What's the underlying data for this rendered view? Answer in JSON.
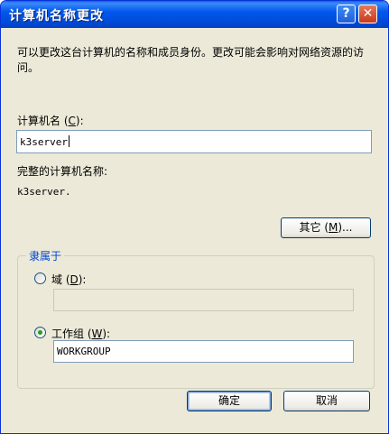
{
  "window": {
    "title": "计算机名称更改",
    "help_label": "?",
    "close_label": "✕"
  },
  "description": "可以更改这台计算机的名称和成员身份。更改可能会影响对网络资源的访问。",
  "computer_name": {
    "label_prefix": "计算机名 (",
    "hotkey": "C",
    "label_suffix": "):",
    "value": "k3server"
  },
  "full_name": {
    "label": "完整的计算机名称:",
    "value": "k3server."
  },
  "more_button": {
    "prefix": "其它 (",
    "hotkey": "M",
    "suffix": ")..."
  },
  "member_of": {
    "legend": "隶属于",
    "domain": {
      "prefix": "域 (",
      "hotkey": "D",
      "suffix": "):",
      "value": "",
      "selected": false
    },
    "workgroup": {
      "prefix": "工作组 (",
      "hotkey": "W",
      "suffix": "):",
      "value": "WORKGROUP",
      "selected": true
    }
  },
  "buttons": {
    "ok": "确定",
    "cancel": "取消"
  }
}
